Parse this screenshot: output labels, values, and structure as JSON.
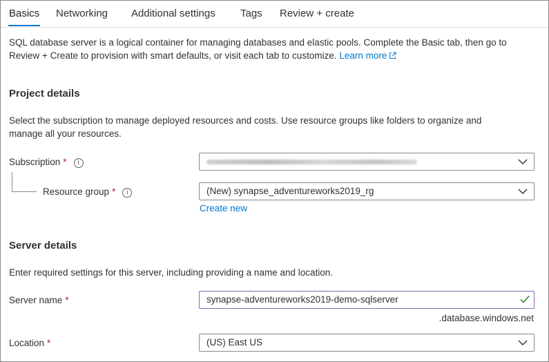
{
  "tabs": [
    {
      "label": "Basics",
      "active": true
    },
    {
      "label": "Networking",
      "active": false
    },
    {
      "label": "Additional settings",
      "active": false
    },
    {
      "label": "Tags",
      "active": false
    },
    {
      "label": "Review + create",
      "active": false
    }
  ],
  "intro": {
    "line1": "SQL database server is a logical container for managing databases and elastic pools. Complete the Basic tab, then go to",
    "line2": "Review + Create to provision with smart defaults, or visit each tab to customize.",
    "learn_more": "Learn more",
    "link_icon": "external-link-icon"
  },
  "project": {
    "title": "Project details",
    "desc_line1": "Select the subscription to manage deployed resources and costs. Use resource groups like folders to organize and",
    "desc_line2": "manage all your resources.",
    "subscription": {
      "label": "Subscription",
      "required_mark": "*",
      "value_blurred": true
    },
    "resource_group": {
      "label": "Resource group",
      "required_mark": "*",
      "value": "(New) synapse_adventureworks2019_rg"
    },
    "create_new": "Create new"
  },
  "server": {
    "title": "Server details",
    "desc": "Enter required settings for this server, including providing a name and location.",
    "server_name": {
      "label": "Server name",
      "required_mark": "*",
      "value": "synapse-adventureworks2019-demo-sqlserver",
      "suffix": ".database.windows.net",
      "valid": true
    },
    "location": {
      "label": "Location",
      "required_mark": "*",
      "value": "(US) East US"
    }
  },
  "colors": {
    "accent": "#0078d4",
    "required": "#a4262c",
    "valid_check": "#107c10",
    "focus_border": "#8764b8"
  }
}
